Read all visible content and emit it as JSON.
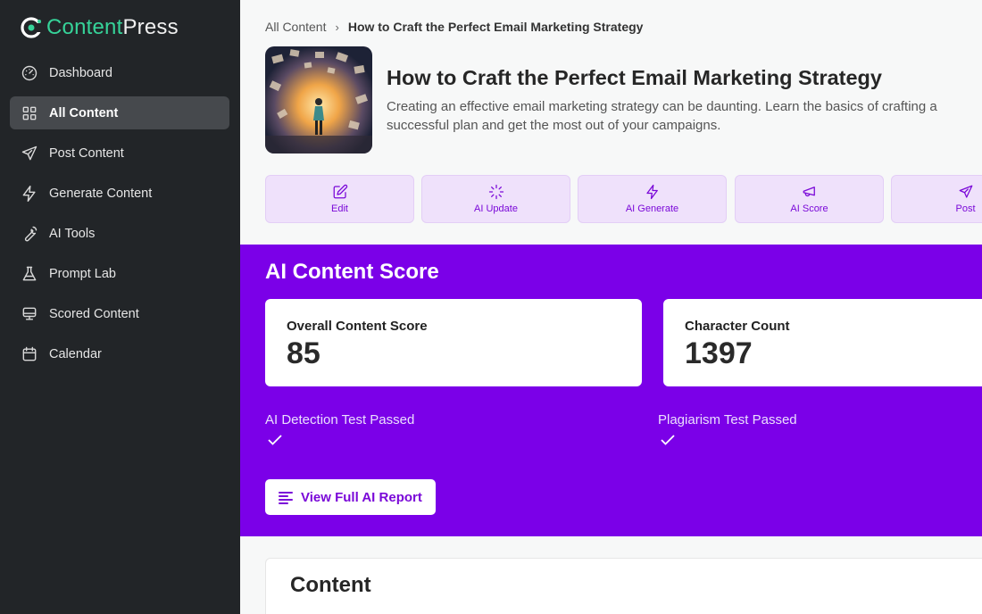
{
  "app": {
    "logo_part1": "Content",
    "logo_part2": "Press",
    "accent": "#7b00e8",
    "brand_green": "#36d399"
  },
  "sidebar": {
    "items": [
      {
        "label": "Dashboard",
        "icon": "gauge-icon"
      },
      {
        "label": "All Content",
        "icon": "grid-icon",
        "active": true
      },
      {
        "label": "Post Content",
        "icon": "send-icon"
      },
      {
        "label": "Generate Content",
        "icon": "lightning-icon"
      },
      {
        "label": "AI Tools",
        "icon": "wrench-icon"
      },
      {
        "label": "Prompt Lab",
        "icon": "flask-icon"
      },
      {
        "label": "Scored Content",
        "icon": "monitor-icon"
      },
      {
        "label": "Calendar",
        "icon": "calendar-icon"
      }
    ]
  },
  "breadcrumb": {
    "root": "All Content",
    "current": "How to Craft the Perfect Email Marketing Strategy"
  },
  "article": {
    "title": "How to Craft the Perfect Email Marketing Strategy",
    "description": "Creating an effective email marketing strategy can be daunting. Learn the basics of crafting a successful plan and get the most out of your campaigns."
  },
  "actions": [
    {
      "label": "Edit",
      "icon": "edit-icon"
    },
    {
      "label": "AI Update",
      "icon": "loader-icon"
    },
    {
      "label": "AI Generate",
      "icon": "lightning-icon"
    },
    {
      "label": "AI Score",
      "icon": "megaphone-icon"
    },
    {
      "label": "Post",
      "icon": "send-icon"
    }
  ],
  "score": {
    "title": "AI Content Score",
    "overall_label": "Overall Content Score",
    "overall_value": "85",
    "char_label": "Character Count",
    "char_value": "1397",
    "ai_detection": "AI Detection Test Passed",
    "plagiarism": "Plagiarism Test Passed",
    "report_button": "View Full AI Report"
  },
  "content_section": {
    "title": "Content"
  }
}
